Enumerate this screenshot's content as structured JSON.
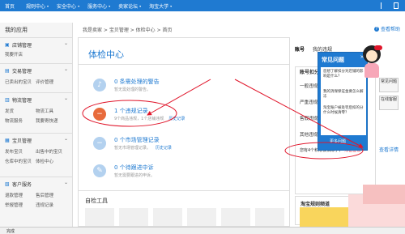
{
  "topnav": {
    "items": [
      "首页",
      "规则中心",
      "安全中心",
      "服务中心",
      "卖家论坛",
      "淘宝大学"
    ]
  },
  "sidebar": {
    "title": "我的应用",
    "sections": [
      {
        "title": "店铺管理",
        "sub1": "我要开店",
        "sub2": ""
      },
      {
        "title": "交易管理",
        "sub1": "已卖出的宝贝",
        "sub2": "评价管理"
      },
      {
        "title": "物流管理",
        "sub1": "发货",
        "sub2": "物流工具",
        "sub3": "物流服务",
        "sub4": "我要寄快递"
      },
      {
        "title": "宝贝管理",
        "sub1": "发布宝贝",
        "sub2": "出售中的宝贝",
        "sub3": "仓库中的宝贝",
        "sub4": "体检中心"
      },
      {
        "title": "客户服务",
        "sub1": "退款管理",
        "sub2": "售后管理",
        "sub3": "举报管理",
        "sub4": "违规记录"
      }
    ]
  },
  "breadcrumb": "我是卖家 > 宝贝管理 > 体检中心 > 首页",
  "help_link": "查看帮助",
  "main": {
    "title": "体检中心",
    "items": [
      {
        "title": "0 条需处理的警告",
        "desc": "暂无需处理的警告。",
        "link": ""
      },
      {
        "title": "1 个违规记录",
        "desc": "9个商品违规，1个店铺违规",
        "link": "历史记录"
      },
      {
        "title": "0 个市场管理记录",
        "desc": "暂无市场管理记录。",
        "link": "历史记录"
      },
      {
        "title": "0 个待跟进中诉",
        "desc": "暂无需要跟进的申诉。",
        "link": ""
      }
    ],
    "tools_title": "自检工具"
  },
  "rpanel": {
    "tabs": [
      "账号",
      "我的违规"
    ],
    "acc_title": "账号扣分",
    "rows": [
      "一般违规",
      "严重违规",
      "售假违规",
      "其他违规"
    ],
    "view_detail": "查看详情",
    "foot_text": "您有4个积限被扣除了，",
    "foot_link": "点击查看",
    "rule_title": "淘宝规则频道",
    "side_btns": [
      "常见问题",
      "在线客服"
    ]
  },
  "faq": {
    "title": "常见问题",
    "questions": [
      "您想了解扣分对店铺的影响是什么？",
      "我的消保保证金要怎么解冻",
      "淘宝账户被处罚后扣的分什么时候清零？"
    ],
    "more": "更多问题"
  },
  "status": "完成"
}
